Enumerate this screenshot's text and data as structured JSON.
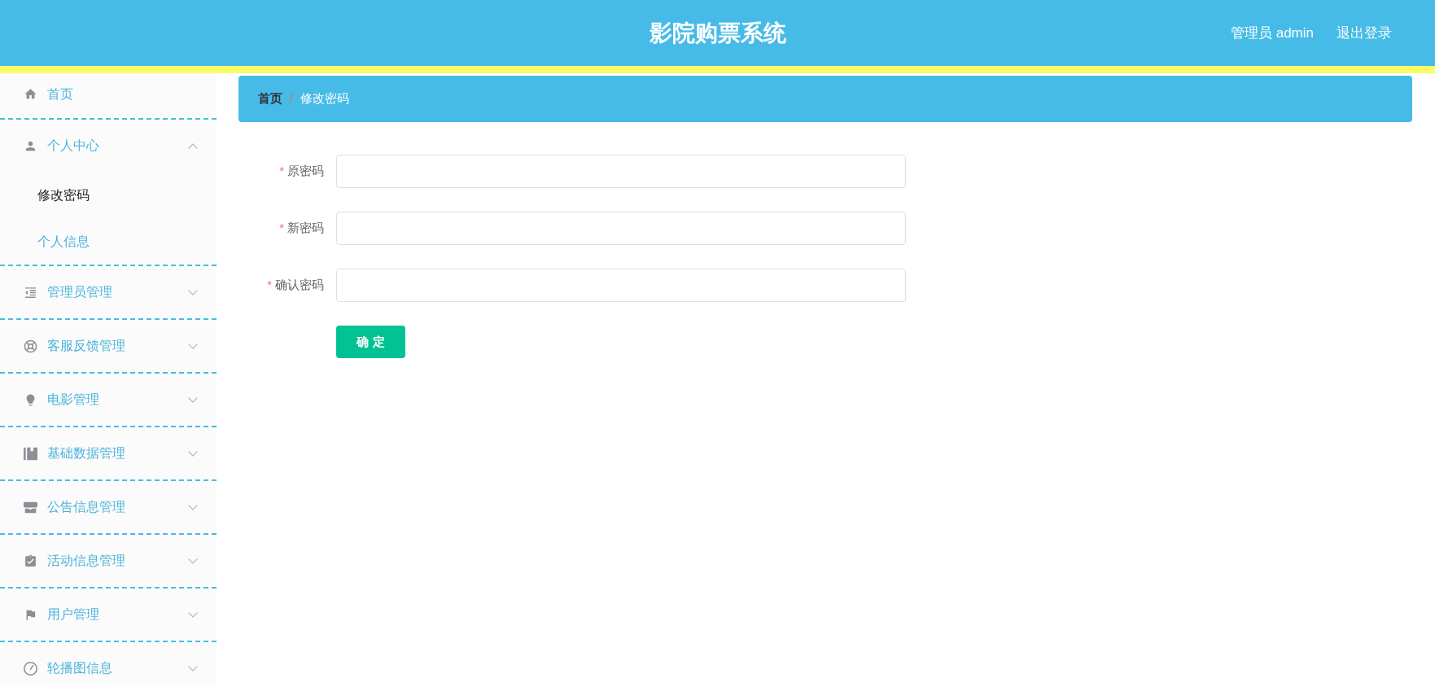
{
  "header": {
    "title": "影院购票系统",
    "user": "管理员 admin",
    "logout": "退出登录"
  },
  "sidebar": {
    "items": [
      {
        "kind": "link",
        "label": "首页"
      },
      {
        "kind": "submenu",
        "label": "个人中心",
        "expanded": true,
        "children": [
          {
            "label": "修改密码",
            "selected": true
          },
          {
            "label": "个人信息",
            "selected": false
          }
        ]
      },
      {
        "kind": "submenu",
        "label": "管理员管理",
        "expanded": false
      },
      {
        "kind": "submenu",
        "label": "客服反馈管理",
        "expanded": false
      },
      {
        "kind": "submenu",
        "label": "电影管理",
        "expanded": false
      },
      {
        "kind": "submenu",
        "label": "基础数据管理",
        "expanded": false
      },
      {
        "kind": "submenu",
        "label": "公告信息管理",
        "expanded": false
      },
      {
        "kind": "submenu",
        "label": "活动信息管理",
        "expanded": false
      },
      {
        "kind": "submenu",
        "label": "用户管理",
        "expanded": false
      },
      {
        "kind": "submenu",
        "label": "轮播图信息",
        "expanded": false
      }
    ]
  },
  "breadcrumb": {
    "separator": "/",
    "items": [
      {
        "label": "首页",
        "current": false
      },
      {
        "label": "修改密码",
        "current": true
      }
    ]
  },
  "form": {
    "fields": [
      {
        "required_mark": "*",
        "label": "原密码"
      },
      {
        "required_mark": "*",
        "label": "新密码"
      },
      {
        "required_mark": "*",
        "label": "确认密码"
      }
    ],
    "submit": "确 定"
  }
}
